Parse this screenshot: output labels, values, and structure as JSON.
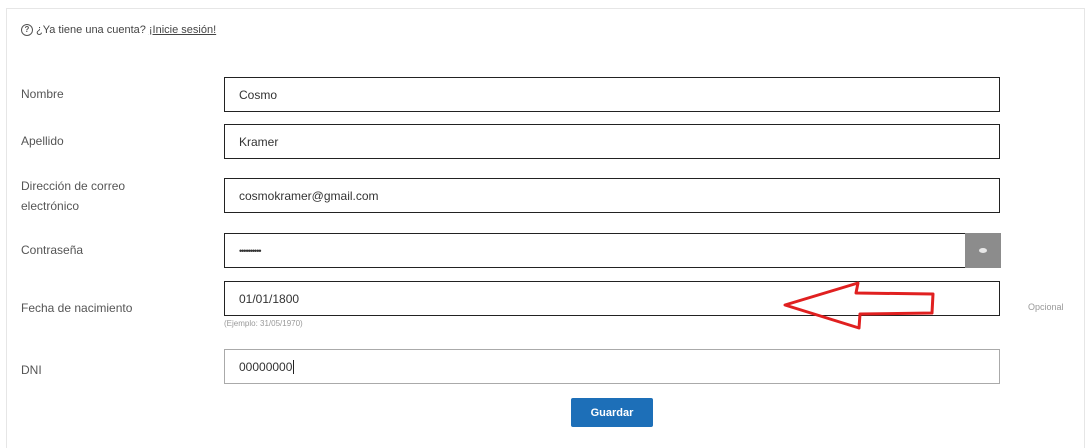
{
  "login_prompt": {
    "help_icon": "question-circle-icon",
    "text": "¿Ya tiene una cuenta?",
    "link": "¡Inicie sesión!"
  },
  "form": {
    "nombre": {
      "label": "Nombre",
      "value": "Cosmo"
    },
    "apellido": {
      "label": "Apellido",
      "value": "Kramer"
    },
    "email": {
      "label": "Dirección de correo electrónico",
      "value": "cosmokramer@gmail.com"
    },
    "password": {
      "label": "Contraseña",
      "value": "••••••••••",
      "toggle_icon": "eye-icon"
    },
    "birthdate": {
      "label": "Fecha de nacimiento",
      "value": "01/01/1800",
      "hint": "(Ejemplo: 31/05/1970)",
      "optional": "Opcional"
    },
    "dni": {
      "label": "DNI",
      "value": "00000000"
    }
  },
  "save_button": {
    "label": "Guardar"
  },
  "colors": {
    "button": "#1d6fb8",
    "annotation_arrow": "#e02020",
    "toggle": "#8c8c8c"
  }
}
